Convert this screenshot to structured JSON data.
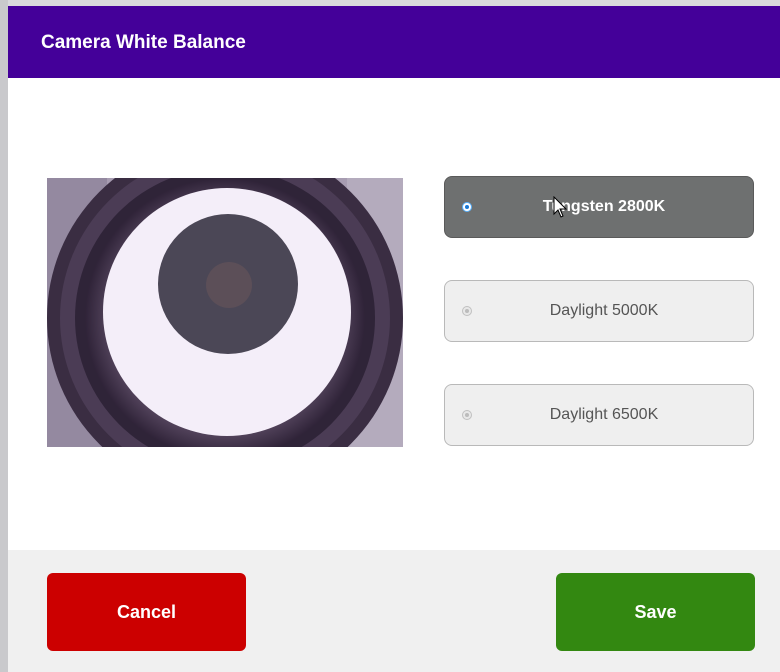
{
  "dialog": {
    "title": "Camera White Balance"
  },
  "preview": {
    "alt": "camera-preview-image"
  },
  "options": [
    {
      "label": "Tungsten 2800K",
      "selected": true
    },
    {
      "label": "Daylight 5000K",
      "selected": false
    },
    {
      "label": "Daylight 6500K",
      "selected": false
    }
  ],
  "footer": {
    "cancel_label": "Cancel",
    "save_label": "Save"
  },
  "colors": {
    "header": "#440099",
    "selected_option": "#6e7070",
    "cancel": "#cc0000",
    "save": "#338811",
    "footer_bg": "#f0f0f0"
  }
}
